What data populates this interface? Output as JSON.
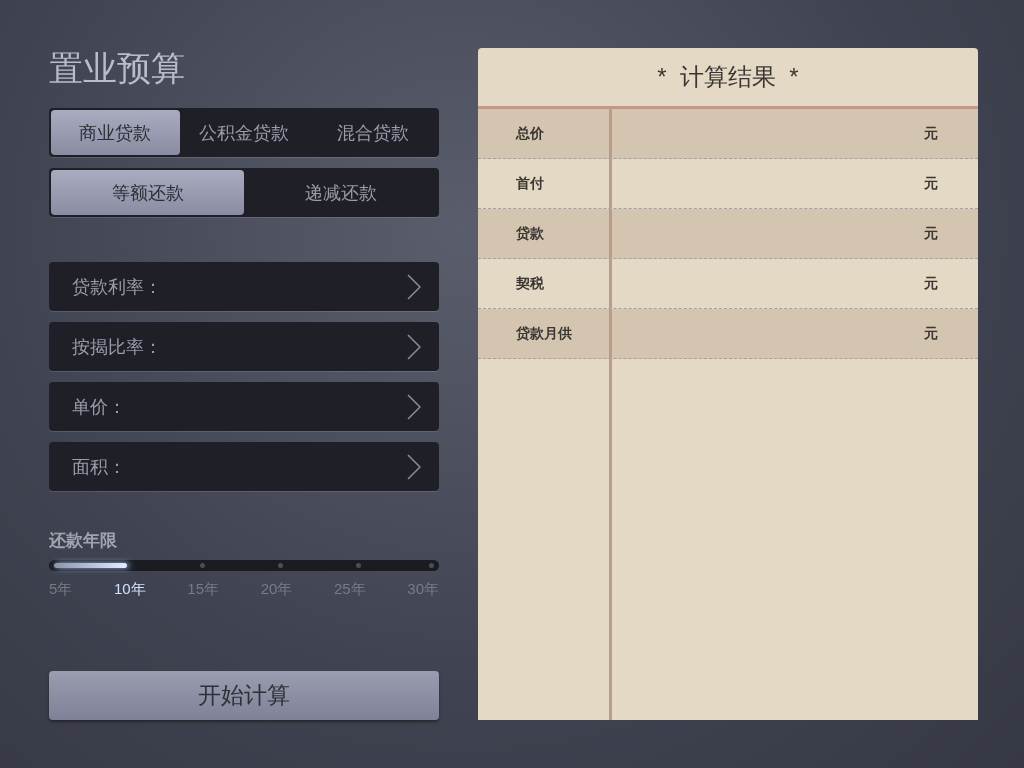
{
  "title": "置业预算",
  "loan_types": [
    {
      "label": "商业贷款",
      "selected": true
    },
    {
      "label": "公积金贷款",
      "selected": false
    },
    {
      "label": "混合贷款",
      "selected": false
    }
  ],
  "repayment_methods": [
    {
      "label": "等额还款",
      "selected": true
    },
    {
      "label": "递减还款",
      "selected": false
    }
  ],
  "fields": [
    {
      "label": "贷款利率："
    },
    {
      "label": "按揭比率："
    },
    {
      "label": "单价："
    },
    {
      "label": "面积："
    }
  ],
  "term": {
    "label": "还款年限",
    "level": 0.2,
    "options": [
      {
        "label": "5年",
        "selected": false
      },
      {
        "label": "10年",
        "selected": true
      },
      {
        "label": "15年",
        "selected": false
      },
      {
        "label": "20年",
        "selected": false
      },
      {
        "label": "25年",
        "selected": false
      },
      {
        "label": "30年",
        "selected": false
      }
    ]
  },
  "calculate_button": "开始计算",
  "results": {
    "title": "*  计算结果  *",
    "rows": [
      {
        "label": "总价",
        "unit": "元"
      },
      {
        "label": "首付",
        "unit": "元"
      },
      {
        "label": "贷款",
        "unit": "元"
      },
      {
        "label": "契税",
        "unit": "元"
      },
      {
        "label": "贷款月供",
        "unit": "元"
      }
    ]
  }
}
